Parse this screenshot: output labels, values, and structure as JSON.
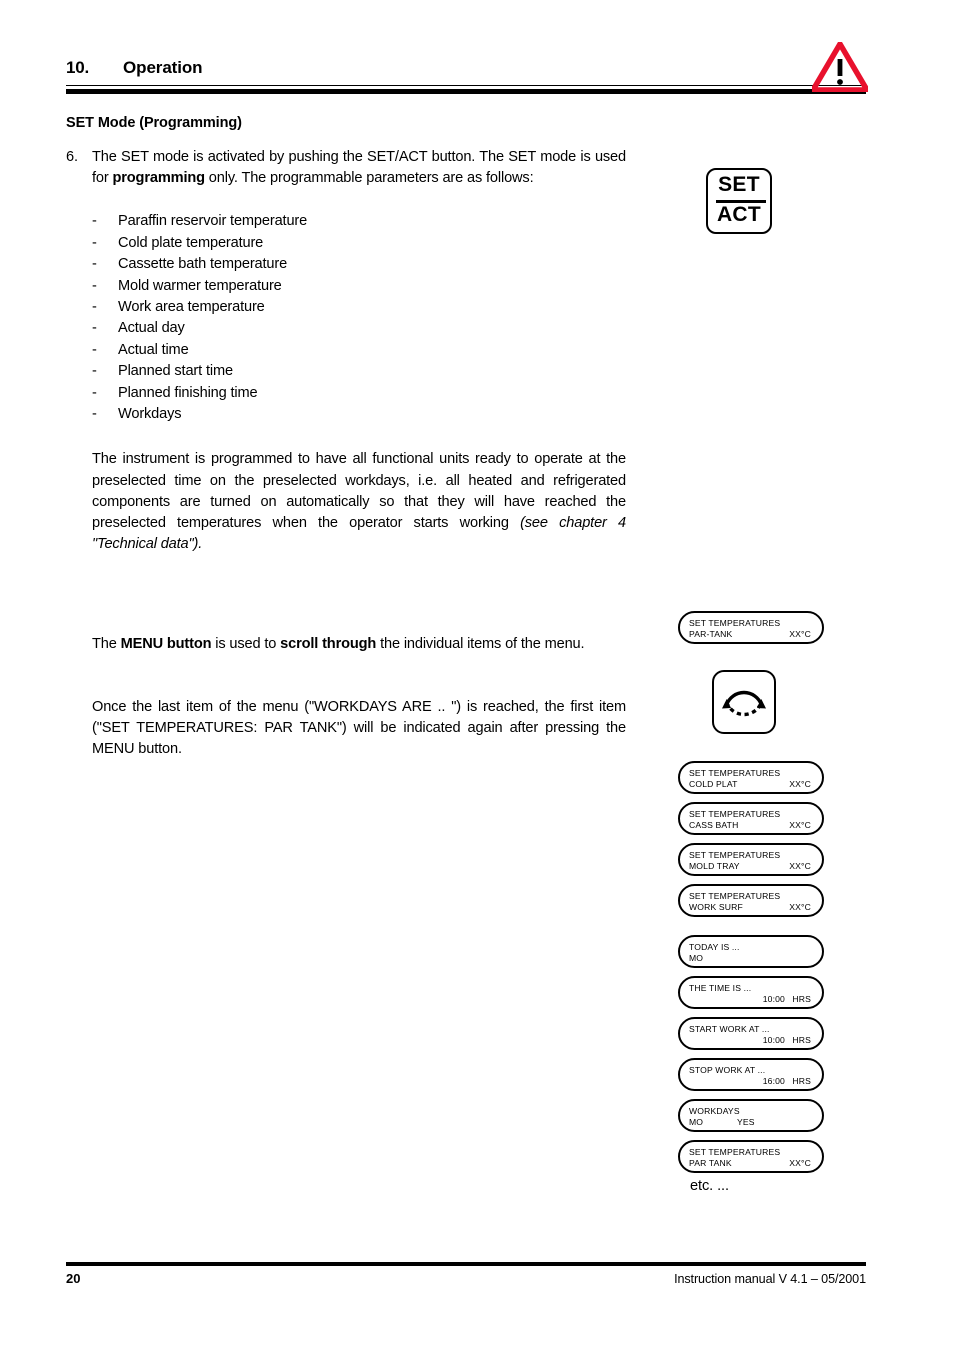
{
  "header": {
    "chapter_number": "10.",
    "chapter_title": "Operation",
    "section_subtitle": "SET Mode (Programming)",
    "warning_icon": "warning-triangle-icon"
  },
  "body": {
    "item_number": "6.",
    "intro_part1": "The SET mode is activated by pushing the SET/ACT button. The SET mode is used for ",
    "intro_bold": "programming",
    "intro_part2": " only. The programmable parameters are as follows:",
    "parameters": [
      "Paraffin reservoir temperature",
      "Cold plate temperature",
      "Cassette bath temperature",
      "Mold warmer temperature",
      "Work area temperature",
      "Actual day",
      "Actual time",
      "Planned start time",
      "Planned finishing time",
      "Workdays"
    ],
    "instrument_para": "The instrument is programmed to have all functional units ready to operate at the preselected time on the preselected workdays, i.e. all heated and refrigerated components are turned on automatically so that they will have reached the preselected temperatures when the operator starts working ",
    "instrument_para_italic": "(see chapter 4 \"Technical data\").",
    "menu_para_1": "The ",
    "menu_para_bold_1": "MENU button",
    "menu_para_2": " is used to ",
    "menu_para_bold_2": "scroll through",
    "menu_para_3": " the individual items of the menu.",
    "once_para": "Once the last item of the menu (\"WORKDAYS ARE .. \") is reached, the first item (\"SET TEMPERATURES: PAR TANK\") will be indicated again after pressing the MENU button."
  },
  "setact_button": {
    "top_label": "SET",
    "bottom_label": "ACT",
    "icon": "setact-button-icon"
  },
  "menu_button": {
    "icon": "circular-arrow-icon"
  },
  "displays": {
    "first": {
      "line1": "SET TEMPERATURES",
      "line2_left": "PAR-TANK",
      "line2_right": "XX°C"
    },
    "sequence": [
      {
        "line1": "SET TEMPERATURES",
        "line2_left": "COLD PLAT",
        "line2_right": "XX°C"
      },
      {
        "line1": "SET TEMPERATURES",
        "line2_left": "CASS BATH",
        "line2_right": "XX°C"
      },
      {
        "line1": "SET TEMPERATURES",
        "line2_left": "MOLD TRAY",
        "line2_right": "XX°C"
      },
      {
        "line1": "SET TEMPERATURES",
        "line2_left": "WORK SURF",
        "line2_right": "XX°C"
      }
    ],
    "schedule": [
      {
        "line1": "TODAY IS ...",
        "line2_left": "MO",
        "line2_value": "",
        "line2_right": ""
      },
      {
        "line1": "THE TIME IS ...",
        "line2_left": "",
        "line2_value": "10:00",
        "line2_right": "HRS"
      },
      {
        "line1": "START WORK AT ...",
        "line2_left": "",
        "line2_value": "10:00",
        "line2_right": "HRS"
      },
      {
        "line1": "STOP WORK AT ...",
        "line2_left": "",
        "line2_value": "16:00",
        "line2_right": "HRS"
      },
      {
        "line1": "WORKDAYS",
        "line2_left": "MO",
        "line2_value": "YES",
        "line2_right": ""
      },
      {
        "line1": "SET TEMPERATURES",
        "line2_left": "PAR TANK",
        "line2_value": "",
        "line2_right": "XX°C"
      }
    ],
    "etc_label": "etc. ..."
  },
  "footer": {
    "page_number": "20",
    "manual_info": "Instruction manual V 4.1 – 05/2001"
  },
  "colors": {
    "warning_red": "#E8112D",
    "text": "#000000",
    "background": "#FFFFFF"
  }
}
